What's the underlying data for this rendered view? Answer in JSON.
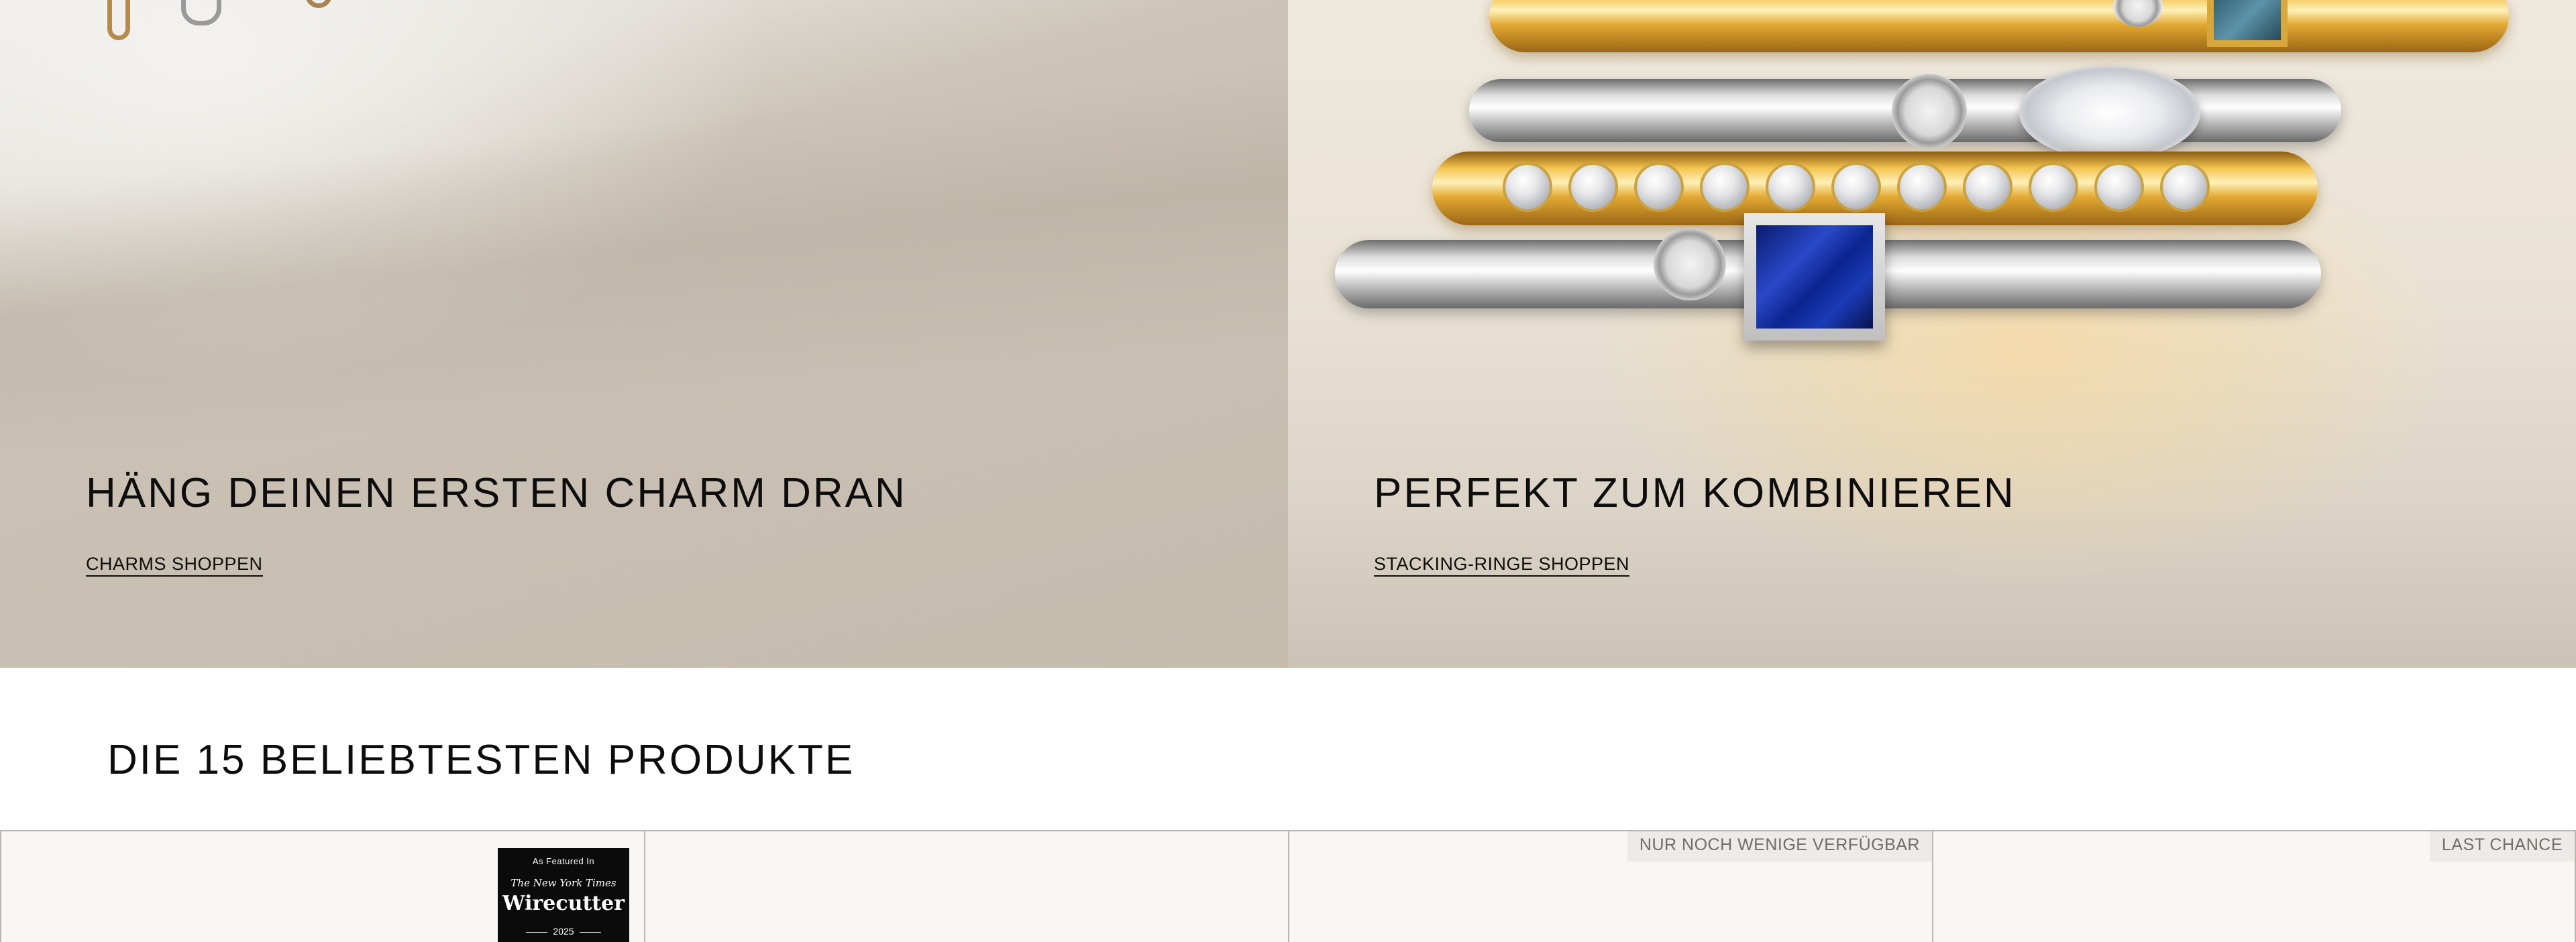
{
  "hero": {
    "left": {
      "title": "HÄNG DEINEN ERSTEN CHARM DRAN",
      "link": "CHARMS SHOPPEN"
    },
    "right": {
      "title": "PERFEKT ZUM KOMBINIEREN",
      "link": "STACKING-RINGE SHOPPEN"
    }
  },
  "bestsellers": {
    "title": "DIE 15 BELIEBTESTEN PRODUKTE",
    "cards": [
      {
        "badge": "",
        "press": {
          "small": "As Featured In",
          "nyt": "The New York Times",
          "big": "Wirecutter",
          "year": "2025"
        }
      },
      {
        "badge": ""
      },
      {
        "badge": "NUR NOCH WENIGE VERFÜGBAR"
      },
      {
        "badge": "LAST CHANCE"
      }
    ]
  },
  "colors": {
    "text": "#0d0d0d",
    "badge_bg": "#ecebe7",
    "badge_text": "#6f6d68",
    "card_bg": "#f8f7f4",
    "grid_line": "#b9b6b0"
  },
  "icons": [
    "wirecutter-badge"
  ]
}
